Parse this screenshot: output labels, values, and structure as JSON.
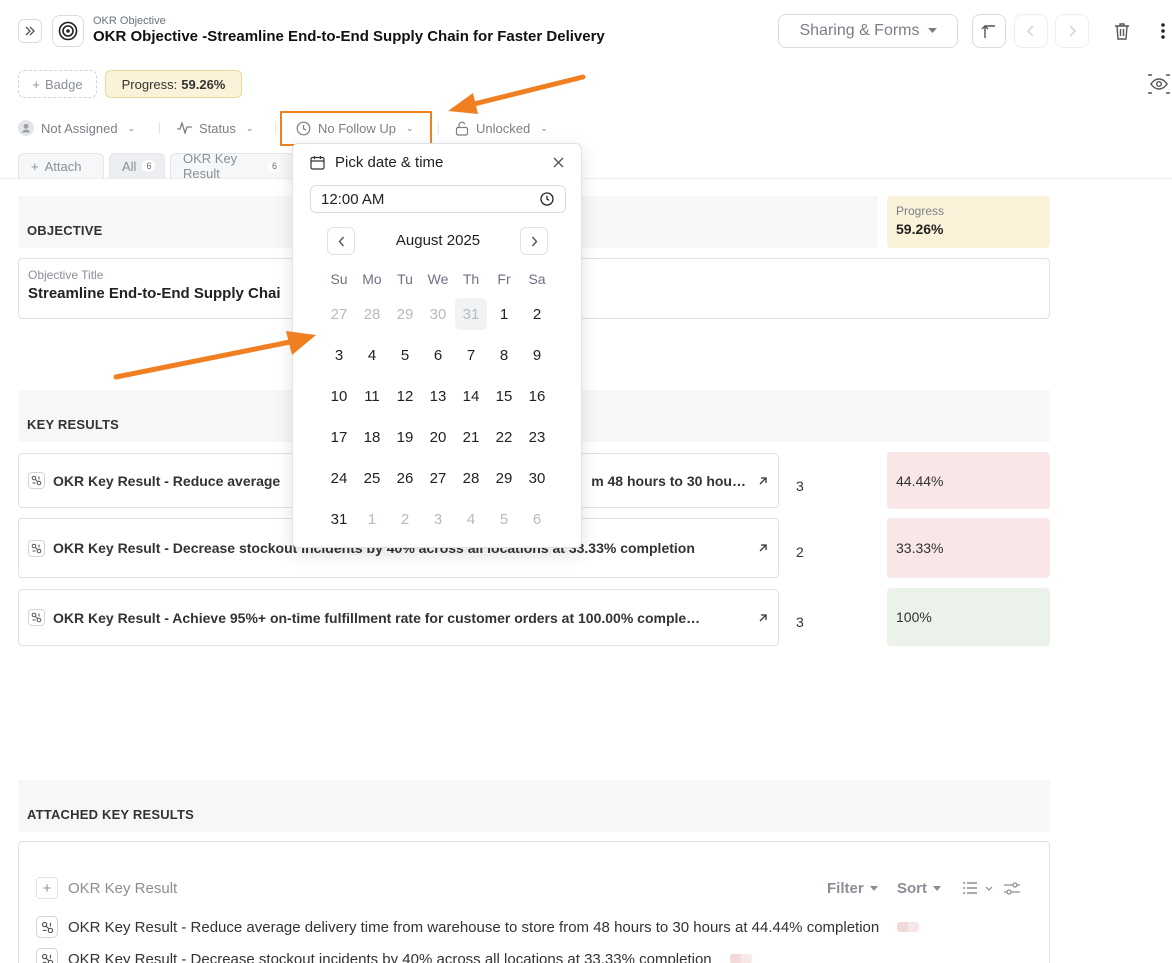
{
  "header": {
    "breadcrumb": "OKR Objective",
    "title": "OKR Objective -Streamline End-to-End Supply Chain for Faster Delivery",
    "share_label": "Sharing & Forms"
  },
  "badges": {
    "add_badge_label": "Badge",
    "progress_label": "Progress:",
    "progress_value": "59.26%"
  },
  "properties": {
    "assignee": "Not Assigned",
    "status": "Status",
    "follow_up": "No Follow Up",
    "lock": "Unlocked"
  },
  "tabs": {
    "attach": "Attach",
    "items": [
      {
        "label": "All",
        "count": "6"
      },
      {
        "label": "OKR Key Result",
        "count": "6"
      }
    ]
  },
  "objective": {
    "section_label": "OBJECTIVE",
    "progress_label": "Progress",
    "progress_value": "59.26%",
    "title_label": "Objective Title",
    "title_value": "Streamline End-to-End Supply Chai"
  },
  "key_results": {
    "section_label": "KEY RESULTS",
    "rows": [
      {
        "text_left": "OKR Key Result - Reduce average",
        "text_right": "m 48 hours to 30 hou…",
        "count": "3",
        "progress": "44.44%"
      },
      {
        "text": "OKR Key Result - Decrease stockout incidents by 40% across all locations at 33.33% completion",
        "count": "2",
        "progress": "33.33%"
      },
      {
        "text": "OKR Key Result - Achieve 95%+ on-time fulfillment rate for customer orders at 100.00% comple…",
        "count": "3",
        "progress": "100%"
      }
    ],
    "colors": {
      "low": "#f9e6e6",
      "done": "#ebf2ea"
    }
  },
  "attached": {
    "section_label": "ATTACHED KEY RESULTS",
    "add_label": "OKR Key Result",
    "filter_label": "Filter",
    "sort_label": "Sort",
    "items": [
      "OKR Key Result - Reduce average delivery time from warehouse to store from 48 hours to 30 hours at 44.44% completion",
      "OKR Key Result - Decrease stockout incidents by 40% across all locations at 33.33% completion"
    ]
  },
  "date_picker": {
    "title": "Pick date & time",
    "time_value": "12:00 AM",
    "month_label": "August 2025",
    "weekdays": [
      "Su",
      "Mo",
      "Tu",
      "We",
      "Th",
      "Fr",
      "Sa"
    ],
    "weeks": [
      [
        "27",
        "28",
        "29",
        "30",
        "31",
        "1",
        "2"
      ],
      [
        "3",
        "4",
        "5",
        "6",
        "7",
        "8",
        "9"
      ],
      [
        "10",
        "11",
        "12",
        "13",
        "14",
        "15",
        "16"
      ],
      [
        "17",
        "18",
        "19",
        "20",
        "21",
        "22",
        "23"
      ],
      [
        "24",
        "25",
        "26",
        "27",
        "28",
        "29",
        "30"
      ],
      [
        "31",
        "1",
        "2",
        "3",
        "4",
        "5",
        "6"
      ]
    ],
    "muted_cells": [
      "0-0",
      "0-1",
      "0-2",
      "0-3",
      "0-4",
      "5-1",
      "5-2",
      "5-3",
      "5-4",
      "5-5",
      "5-6"
    ],
    "today_cell": "0-4"
  },
  "annotation_color": "#f07f22"
}
